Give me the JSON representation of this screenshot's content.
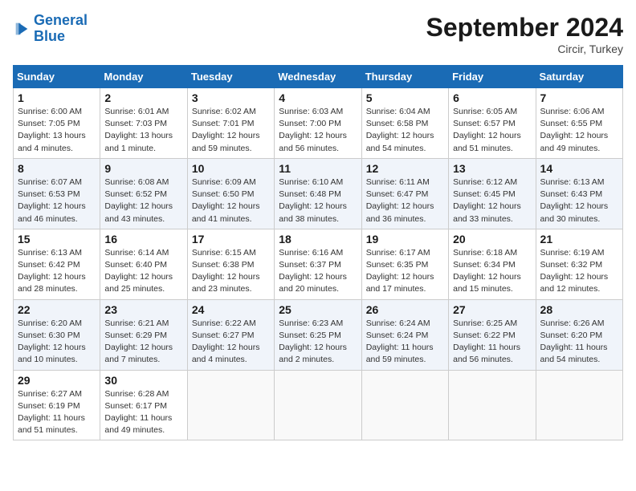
{
  "header": {
    "logo_line1": "General",
    "logo_line2": "Blue",
    "month_title": "September 2024",
    "subtitle": "Circir, Turkey"
  },
  "weekdays": [
    "Sunday",
    "Monday",
    "Tuesday",
    "Wednesday",
    "Thursday",
    "Friday",
    "Saturday"
  ],
  "weeks": [
    [
      {
        "day": "1",
        "info": "Sunrise: 6:00 AM\nSunset: 7:05 PM\nDaylight: 13 hours\nand 4 minutes."
      },
      {
        "day": "2",
        "info": "Sunrise: 6:01 AM\nSunset: 7:03 PM\nDaylight: 13 hours\nand 1 minute."
      },
      {
        "day": "3",
        "info": "Sunrise: 6:02 AM\nSunset: 7:01 PM\nDaylight: 12 hours\nand 59 minutes."
      },
      {
        "day": "4",
        "info": "Sunrise: 6:03 AM\nSunset: 7:00 PM\nDaylight: 12 hours\nand 56 minutes."
      },
      {
        "day": "5",
        "info": "Sunrise: 6:04 AM\nSunset: 6:58 PM\nDaylight: 12 hours\nand 54 minutes."
      },
      {
        "day": "6",
        "info": "Sunrise: 6:05 AM\nSunset: 6:57 PM\nDaylight: 12 hours\nand 51 minutes."
      },
      {
        "day": "7",
        "info": "Sunrise: 6:06 AM\nSunset: 6:55 PM\nDaylight: 12 hours\nand 49 minutes."
      }
    ],
    [
      {
        "day": "8",
        "info": "Sunrise: 6:07 AM\nSunset: 6:53 PM\nDaylight: 12 hours\nand 46 minutes."
      },
      {
        "day": "9",
        "info": "Sunrise: 6:08 AM\nSunset: 6:52 PM\nDaylight: 12 hours\nand 43 minutes."
      },
      {
        "day": "10",
        "info": "Sunrise: 6:09 AM\nSunset: 6:50 PM\nDaylight: 12 hours\nand 41 minutes."
      },
      {
        "day": "11",
        "info": "Sunrise: 6:10 AM\nSunset: 6:48 PM\nDaylight: 12 hours\nand 38 minutes."
      },
      {
        "day": "12",
        "info": "Sunrise: 6:11 AM\nSunset: 6:47 PM\nDaylight: 12 hours\nand 36 minutes."
      },
      {
        "day": "13",
        "info": "Sunrise: 6:12 AM\nSunset: 6:45 PM\nDaylight: 12 hours\nand 33 minutes."
      },
      {
        "day": "14",
        "info": "Sunrise: 6:13 AM\nSunset: 6:43 PM\nDaylight: 12 hours\nand 30 minutes."
      }
    ],
    [
      {
        "day": "15",
        "info": "Sunrise: 6:13 AM\nSunset: 6:42 PM\nDaylight: 12 hours\nand 28 minutes."
      },
      {
        "day": "16",
        "info": "Sunrise: 6:14 AM\nSunset: 6:40 PM\nDaylight: 12 hours\nand 25 minutes."
      },
      {
        "day": "17",
        "info": "Sunrise: 6:15 AM\nSunset: 6:38 PM\nDaylight: 12 hours\nand 23 minutes."
      },
      {
        "day": "18",
        "info": "Sunrise: 6:16 AM\nSunset: 6:37 PM\nDaylight: 12 hours\nand 20 minutes."
      },
      {
        "day": "19",
        "info": "Sunrise: 6:17 AM\nSunset: 6:35 PM\nDaylight: 12 hours\nand 17 minutes."
      },
      {
        "day": "20",
        "info": "Sunrise: 6:18 AM\nSunset: 6:34 PM\nDaylight: 12 hours\nand 15 minutes."
      },
      {
        "day": "21",
        "info": "Sunrise: 6:19 AM\nSunset: 6:32 PM\nDaylight: 12 hours\nand 12 minutes."
      }
    ],
    [
      {
        "day": "22",
        "info": "Sunrise: 6:20 AM\nSunset: 6:30 PM\nDaylight: 12 hours\nand 10 minutes."
      },
      {
        "day": "23",
        "info": "Sunrise: 6:21 AM\nSunset: 6:29 PM\nDaylight: 12 hours\nand 7 minutes."
      },
      {
        "day": "24",
        "info": "Sunrise: 6:22 AM\nSunset: 6:27 PM\nDaylight: 12 hours\nand 4 minutes."
      },
      {
        "day": "25",
        "info": "Sunrise: 6:23 AM\nSunset: 6:25 PM\nDaylight: 12 hours\nand 2 minutes."
      },
      {
        "day": "26",
        "info": "Sunrise: 6:24 AM\nSunset: 6:24 PM\nDaylight: 11 hours\nand 59 minutes."
      },
      {
        "day": "27",
        "info": "Sunrise: 6:25 AM\nSunset: 6:22 PM\nDaylight: 11 hours\nand 56 minutes."
      },
      {
        "day": "28",
        "info": "Sunrise: 6:26 AM\nSunset: 6:20 PM\nDaylight: 11 hours\nand 54 minutes."
      }
    ],
    [
      {
        "day": "29",
        "info": "Sunrise: 6:27 AM\nSunset: 6:19 PM\nDaylight: 11 hours\nand 51 minutes."
      },
      {
        "day": "30",
        "info": "Sunrise: 6:28 AM\nSunset: 6:17 PM\nDaylight: 11 hours\nand 49 minutes."
      },
      {
        "day": "",
        "info": ""
      },
      {
        "day": "",
        "info": ""
      },
      {
        "day": "",
        "info": ""
      },
      {
        "day": "",
        "info": ""
      },
      {
        "day": "",
        "info": ""
      }
    ]
  ]
}
